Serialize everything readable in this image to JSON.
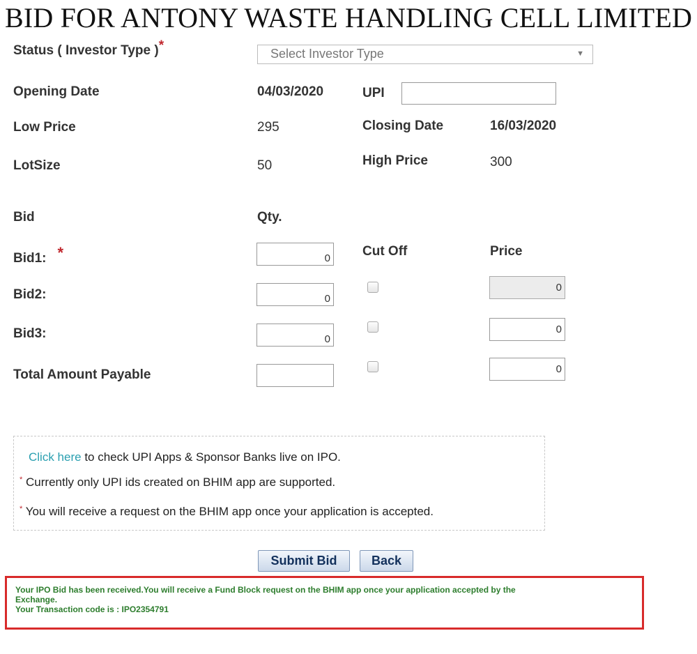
{
  "title": "BID FOR ANTONY WASTE HANDLING CELL LIMITED",
  "status": {
    "label": "Status ( Investor Type )",
    "required": "*",
    "select_placeholder": "Select Investor Type",
    "arrow_icon": "triangle-down-icon"
  },
  "details": {
    "opening_date_label": "Opening Date",
    "opening_date": "04/03/2020",
    "upi_label": "UPI",
    "upi_value": "",
    "low_price_label": "Low Price",
    "low_price": "295",
    "closing_date_label": "Closing Date",
    "closing_date": "16/03/2020",
    "lot_size_label": "LotSize",
    "lot_size": "50",
    "high_price_label": "High Price",
    "high_price": "300"
  },
  "bids": {
    "header_bid": "Bid",
    "header_qty": "Qty.",
    "header_cutoff": "Cut Off",
    "header_price": "Price",
    "required": "*",
    "rows": [
      {
        "label": "Bid1:",
        "qty": "0",
        "cutoff_checked": false,
        "price": "0",
        "price_disabled": true
      },
      {
        "label": "Bid2:",
        "qty": "0",
        "cutoff_checked": false,
        "price": "0",
        "price_disabled": false
      },
      {
        "label": "Bid3:",
        "qty": "0",
        "cutoff_checked": false,
        "price": "0",
        "price_disabled": false
      }
    ],
    "total_label": "Total Amount Payable",
    "total_value": ""
  },
  "info": {
    "link_text": "Click here",
    "line1_rest": " to check UPI Apps & Sponsor Banks live on IPO.",
    "note_mark": "*",
    "line2": "Currently only UPI ids created on BHIM app are supported.",
    "line3": "You will receive a request on the BHIM app once your application is accepted."
  },
  "buttons": {
    "submit": "Submit Bid",
    "back": "Back"
  },
  "message": {
    "line1": "Your IPO Bid has been received.You will receive a Fund Block request on the BHIM app once your application accepted by the",
    "line2": "Exchange.",
    "line3": "Your Transaction code is : IPO2354791"
  },
  "colors": {
    "required_star": "#c0272d",
    "link": "#2a9fb0",
    "message_border": "#d82b2b",
    "message_text": "#2d7d2d"
  }
}
